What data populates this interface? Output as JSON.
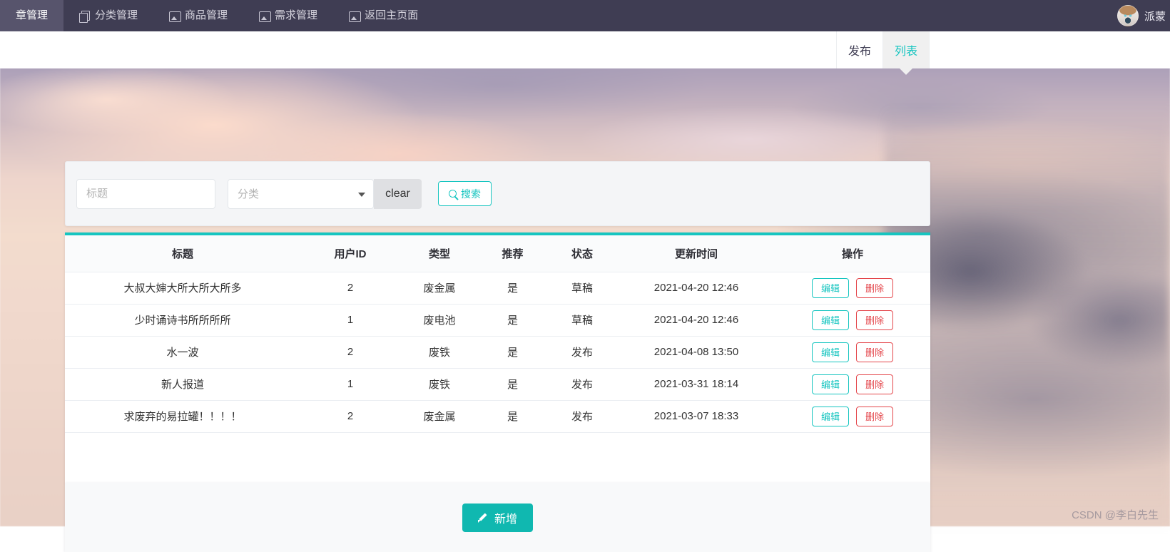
{
  "topnav": {
    "items": [
      {
        "label": "章管理",
        "icon": "article-icon",
        "active": true
      },
      {
        "label": "分类管理",
        "icon": "copy-icon",
        "active": false
      },
      {
        "label": "商品管理",
        "icon": "image-icon",
        "active": false
      },
      {
        "label": "需求管理",
        "icon": "image-icon",
        "active": false
      },
      {
        "label": "返回主页面",
        "icon": "image-icon",
        "active": false
      }
    ],
    "user": {
      "name": "派蒙",
      "avatar": "user-avatar"
    }
  },
  "tabs": [
    {
      "label": "发布",
      "active": false
    },
    {
      "label": "列表",
      "active": true
    }
  ],
  "search": {
    "title_placeholder": "标题",
    "title_value": "",
    "category_placeholder": "分类",
    "category_value": "",
    "clear_label": "clear",
    "search_label": "搜索"
  },
  "table": {
    "headers": [
      "标题",
      "用户ID",
      "类型",
      "推荐",
      "状态",
      "更新时间",
      "操作"
    ],
    "rows": [
      {
        "title": "大叔大婶大所大所大所多",
        "uid": "2",
        "type": "废金属",
        "recommend": "是",
        "state": "草稿",
        "updated": "2021-04-20 12:46",
        "edit": "编辑",
        "del": "删除"
      },
      {
        "title": "少时诵诗书所所所所",
        "uid": "1",
        "type": "废电池",
        "recommend": "是",
        "state": "草稿",
        "updated": "2021-04-20 12:46",
        "edit": "编辑",
        "del": "删除"
      },
      {
        "title": "水一波",
        "uid": "2",
        "type": "废铁",
        "recommend": "是",
        "state": "发布",
        "updated": "2021-04-08 13:50",
        "edit": "编辑",
        "del": "删除"
      },
      {
        "title": "新人报道",
        "uid": "1",
        "type": "废铁",
        "recommend": "是",
        "state": "发布",
        "updated": "2021-03-31 18:14",
        "edit": "编辑",
        "del": "删除"
      },
      {
        "title": "求废弃的易拉罐！！！！",
        "uid": "2",
        "type": "废金属",
        "recommend": "是",
        "state": "发布",
        "updated": "2021-03-07 18:33",
        "edit": "编辑",
        "del": "删除"
      }
    ]
  },
  "footer": {
    "add_label": "新增"
  },
  "watermark": "CSDN @李白先生",
  "colors": {
    "accent_teal": "#16c5c0",
    "add_button": "#10b8b0",
    "delete_red": "#e4464b",
    "navbar": "#3f3d53",
    "navbar_active": "#57546c",
    "tab_active_bg": "#f0f0f0",
    "search_card_bg": "#f4f5f7",
    "table_header_bg": "#fafbfc",
    "footer_bg": "#f8f9fa"
  }
}
